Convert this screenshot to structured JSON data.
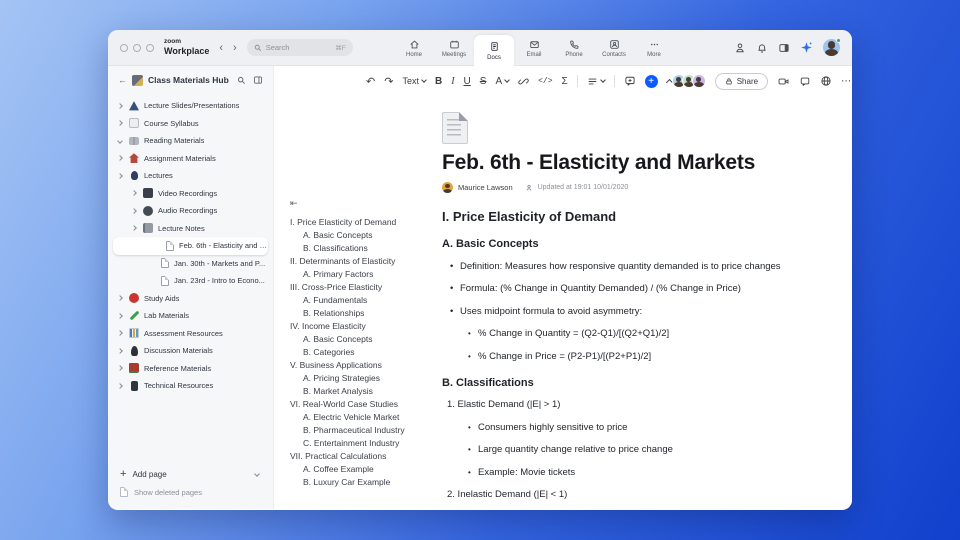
{
  "colors": {
    "accent": "#0b5cff",
    "presence_green": "#27ae60"
  },
  "icons": {
    "plus": "+",
    "undo": "↶",
    "redo": "↷",
    "more_dots": "⋯",
    "collapse_outline": "⇤",
    "back_arrow": "←",
    "nav_back": "‹",
    "nav_forward": "›"
  },
  "topbar": {
    "brand": {
      "top": "zoom",
      "bottom": "Workplace"
    },
    "search": {
      "placeholder": "Search",
      "shortcut": "⌘F"
    },
    "tabs": [
      {
        "id": "home",
        "label": "Home"
      },
      {
        "id": "meetings",
        "label": "Meetings"
      },
      {
        "id": "docs",
        "label": "Docs",
        "active": true
      },
      {
        "id": "email",
        "label": "Email"
      },
      {
        "id": "phone",
        "label": "Phone"
      },
      {
        "id": "contacts",
        "label": "Contacts"
      },
      {
        "id": "more",
        "label": "More"
      }
    ]
  },
  "toolbar": {
    "style_selector": "Text",
    "bold": "B",
    "italic": "I",
    "underline": "U",
    "strikethrough": "S",
    "text_color": "A",
    "code": "</>",
    "equation": "Σ",
    "share": "Share"
  },
  "sidebar": {
    "title": "Class Materials Hub",
    "items": [
      {
        "label": "Lecture Slides/Presentations",
        "icon": "slides",
        "chevron": "right",
        "level": 0
      },
      {
        "label": "Course Syllabus",
        "icon": "syllabus",
        "chevron": "right",
        "level": 0
      },
      {
        "label": "Reading Materials",
        "icon": "book",
        "chevron": "down",
        "level": 0
      },
      {
        "label": "Assignment Materials",
        "icon": "house",
        "chevron": "right",
        "level": 0
      },
      {
        "label": "Lectures",
        "icon": "mic",
        "chevron": "right",
        "level": 0
      },
      {
        "label": "Video Recordings",
        "icon": "video",
        "chevron": "right",
        "level": 1
      },
      {
        "label": "Audio Recordings",
        "icon": "audio",
        "chevron": "right",
        "level": 1
      },
      {
        "label": "Lecture Notes",
        "icon": "notes",
        "chevron": "right",
        "level": 1
      },
      {
        "label": "Feb. 6th - Elasticity and M...",
        "icon": "page",
        "level": 2,
        "selected": true
      },
      {
        "label": "Jan. 30th - Markets and P...",
        "icon": "page",
        "level": 2
      },
      {
        "label": "Jan. 23rd - Intro to Econo...",
        "icon": "page",
        "level": 2
      },
      {
        "label": "Study Aids",
        "icon": "apple",
        "chevron": "right",
        "level": 0
      },
      {
        "label": "Lab Materials",
        "icon": "pen",
        "chevron": "right",
        "level": 0
      },
      {
        "label": "Assessment Resources",
        "icon": "chart",
        "chevron": "right",
        "level": 0
      },
      {
        "label": "Discussion Materials",
        "icon": "pawn",
        "chevron": "right",
        "level": 0
      },
      {
        "label": "Reference Materials",
        "icon": "refbook",
        "chevron": "right",
        "level": 0
      },
      {
        "label": "Technical Resources",
        "icon": "tech",
        "chevron": "right",
        "level": 0
      }
    ],
    "add_page": "Add page",
    "show_deleted": "Show deleted pages"
  },
  "document": {
    "title": "Feb. 6th - Elasticity and Markets",
    "author": "Maurice Lawson",
    "updated": "Updated at 19:01 10/01/2020",
    "outline": [
      {
        "t": "I. Price Elasticity of Demand",
        "l": 1
      },
      {
        "t": "A. Basic Concepts",
        "l": 2
      },
      {
        "t": "B. Classifications",
        "l": 2
      },
      {
        "t": "II. Determinants of Elasticity",
        "l": 1
      },
      {
        "t": "A. Primary Factors",
        "l": 2
      },
      {
        "t": "III. Cross-Price Elasticity",
        "l": 1
      },
      {
        "t": "A. Fundamentals",
        "l": 2
      },
      {
        "t": "B. Relationships",
        "l": 2
      },
      {
        "t": "IV. Income Elasticity",
        "l": 1
      },
      {
        "t": "A. Basic Concepts",
        "l": 2
      },
      {
        "t": "B. Categories",
        "l": 2
      },
      {
        "t": "V. Business Applications",
        "l": 1
      },
      {
        "t": "A. Pricing Strategies",
        "l": 2
      },
      {
        "t": "B. Market Analysis",
        "l": 2
      },
      {
        "t": "VI. Real-World Case Studies",
        "l": 1
      },
      {
        "t": "A. Electric Vehicle Market",
        "l": 2
      },
      {
        "t": "B. Pharmaceutical Industry",
        "l": 2
      },
      {
        "t": "C. Entertainment Industry",
        "l": 2
      },
      {
        "t": "VII. Practical Calculations",
        "l": 1
      },
      {
        "t": "A. Coffee Example",
        "l": 2
      },
      {
        "t": "B. Luxury Car Example",
        "l": 2
      }
    ],
    "body": [
      {
        "type": "h2",
        "text": "I. Price Elasticity of Demand"
      },
      {
        "type": "h3",
        "text": "A. Basic Concepts"
      },
      {
        "type": "bullet",
        "level": 1,
        "text": "Definition: Measures how responsive quantity demanded is to price changes"
      },
      {
        "type": "bullet",
        "level": 1,
        "text": "Formula: (% Change in Quantity Demanded) / (% Change in Price)"
      },
      {
        "type": "bullet",
        "level": 1,
        "text": "Uses midpoint formula to avoid asymmetry:"
      },
      {
        "type": "bullet",
        "level": 2,
        "text": "% Change in Quantity = (Q2-Q1)/[(Q2+Q1)/2]"
      },
      {
        "type": "bullet",
        "level": 2,
        "text": "% Change in Price = (P2-P1)/[(P2+P1)/2]"
      },
      {
        "type": "h3",
        "text": "B. Classifications"
      },
      {
        "type": "num",
        "text": "1. Elastic Demand (|E| > 1)"
      },
      {
        "type": "bullet",
        "level": 2,
        "text": "Consumers highly sensitive to price"
      },
      {
        "type": "bullet",
        "level": 2,
        "text": "Large quantity change relative to price change"
      },
      {
        "type": "bullet",
        "level": 2,
        "text": "Example: Movie tickets"
      },
      {
        "type": "num",
        "text": "2. Inelastic Demand (|E| < 1)"
      }
    ]
  }
}
